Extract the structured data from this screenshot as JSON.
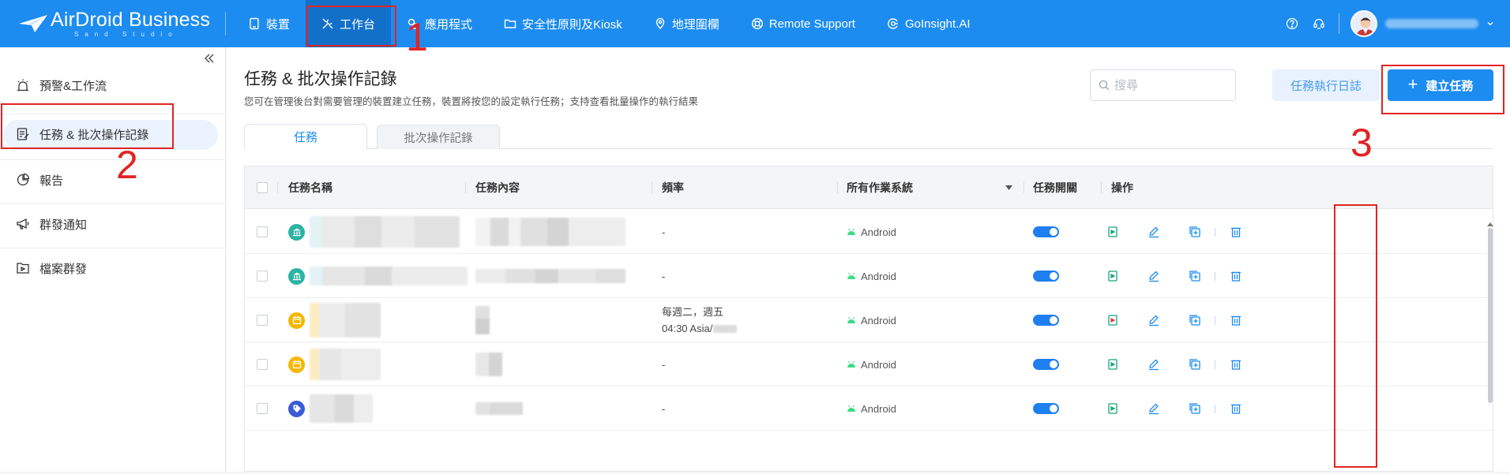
{
  "app": {
    "logo_text": "AirDroid Business",
    "logo_subtext": "Sand Studio"
  },
  "nav": [
    {
      "label": "裝置",
      "icon": "device-icon"
    },
    {
      "label": "工作台",
      "icon": "tools-icon",
      "active": true
    },
    {
      "label": "應用程式",
      "icon": "app-icon"
    },
    {
      "label": "安全性原則及Kiosk",
      "icon": "folder-icon"
    },
    {
      "label": "地理圍欄",
      "icon": "map-pin-icon"
    },
    {
      "label": "Remote Support",
      "icon": "lifebuoy-icon"
    },
    {
      "label": "GoInsight.AI",
      "icon": "ai-icon"
    }
  ],
  "sidebar": {
    "items": [
      {
        "label": "預警&工作流",
        "icon": "alert-icon"
      },
      {
        "label": "任務 & 批次操作記錄",
        "icon": "task-list-icon",
        "active": true
      },
      {
        "label": "報告",
        "icon": "pie-chart-icon"
      },
      {
        "label": "群發通知",
        "icon": "megaphone-icon"
      },
      {
        "label": "檔案群發",
        "icon": "file-send-icon"
      }
    ]
  },
  "page": {
    "title": "任務 & 批次操作記錄",
    "description": "您可在管理後台對需要管理的裝置建立任務，裝置將按您的設定執行任務；支持查看批量操作的執行結果",
    "search_placeholder": "搜尋",
    "log_button": "任務執行日誌",
    "create_button": "建立任務"
  },
  "tabs": [
    {
      "label": "任務",
      "active": true
    },
    {
      "label": "批次操作記錄"
    }
  ],
  "table": {
    "columns": {
      "name": "任務名稱",
      "content": "任務內容",
      "frequency": "頻率",
      "os": "所有作業系統",
      "switch": "任務開關",
      "actions": "操作"
    },
    "rows": [
      {
        "icon_color": "#2bb3a3",
        "icon": "bank-icon",
        "frequency_line1": "-",
        "frequency_line2": "",
        "os": "Android",
        "enabled": true
      },
      {
        "icon_color": "#2bb3a3",
        "icon": "bank-icon",
        "frequency_line1": "-",
        "frequency_line2": "",
        "os": "Android",
        "enabled": true
      },
      {
        "icon_color": "#f5b700",
        "icon": "calendar-icon",
        "frequency_line1": "每週二，週五",
        "frequency_line2": "04:30 Asia/",
        "os": "Android",
        "enabled": true
      },
      {
        "icon_color": "#f5b700",
        "icon": "calendar-icon",
        "frequency_line1": "-",
        "frequency_line2": "",
        "os": "Android",
        "enabled": true
      },
      {
        "icon_color": "#3a5bd6",
        "icon": "tag-icon",
        "frequency_line1": "-",
        "frequency_line2": "",
        "os": "Android",
        "enabled": true
      }
    ]
  },
  "annotations": [
    "1",
    "2",
    "3"
  ],
  "colors": {
    "brand": "#1d8cf0",
    "annotation": "#e02424",
    "android": "#3ddc84"
  }
}
